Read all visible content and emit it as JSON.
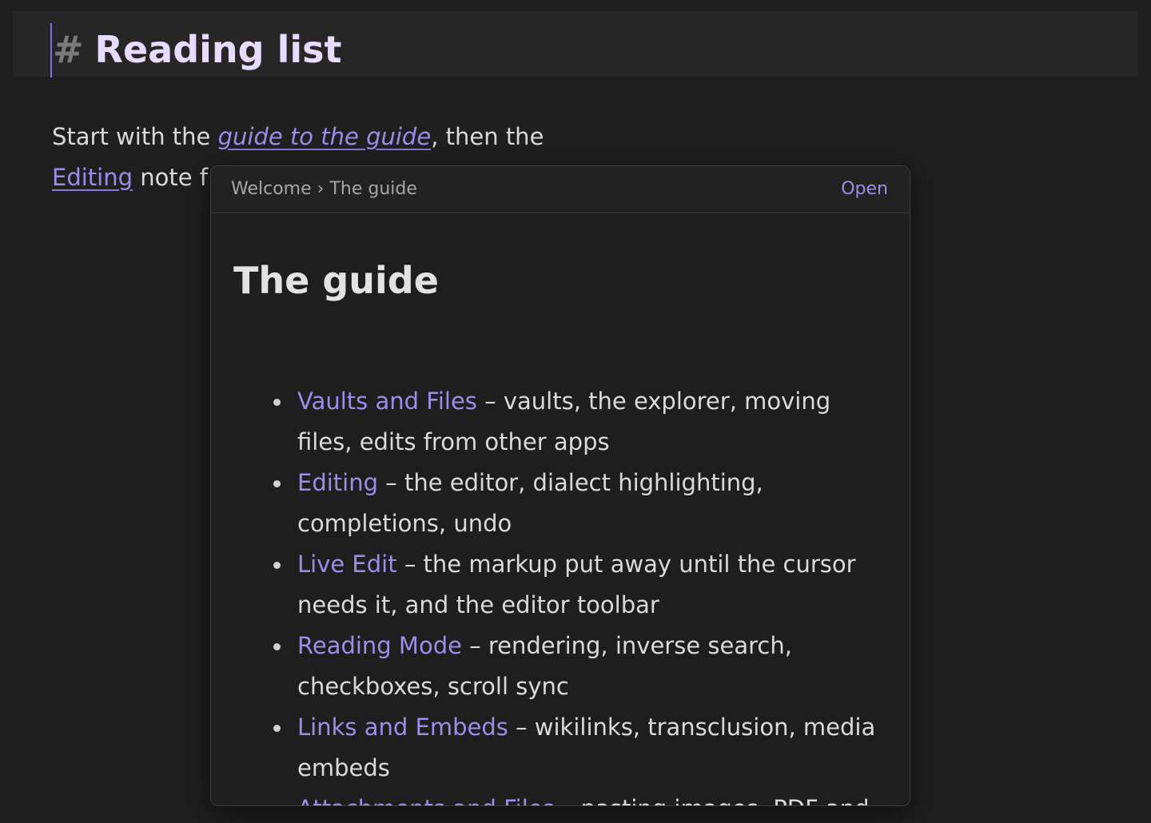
{
  "heading": {
    "hash": "#",
    "title": "Reading list"
  },
  "body": {
    "line1_prefix": "Start with the ",
    "line1_link": "guide to the guide",
    "line1_suffix": ", then the",
    "line2_link": "Editing",
    "line2_suffix": " note f"
  },
  "popover": {
    "breadcrumb": [
      "Welcome",
      "The guide"
    ],
    "breadcrumb_separator": "›",
    "open_label": "Open",
    "title": "The guide",
    "items": [
      {
        "link": "Vaults and Files",
        "text": " – vaults, the explorer, moving files, edits from other apps"
      },
      {
        "link": "Editing",
        "text": " – the editor, dialect highlighting, completions, undo"
      },
      {
        "link": "Live Edit",
        "text": " – the markup put away until the cursor needs it, and the editor toolbar"
      },
      {
        "link": "Reading Mode",
        "text": " – rendering, inverse search, checkboxes, scroll sync"
      },
      {
        "link": "Links and Embeds",
        "text": " – wikilinks, transclusion, media embeds"
      },
      {
        "link": "Attachments and Files",
        "text": " – pasting images, PDF and"
      }
    ]
  },
  "colors": {
    "accent": "#9d8de8",
    "background": "#1f1f1f",
    "heading_text": "#e6dcff"
  }
}
